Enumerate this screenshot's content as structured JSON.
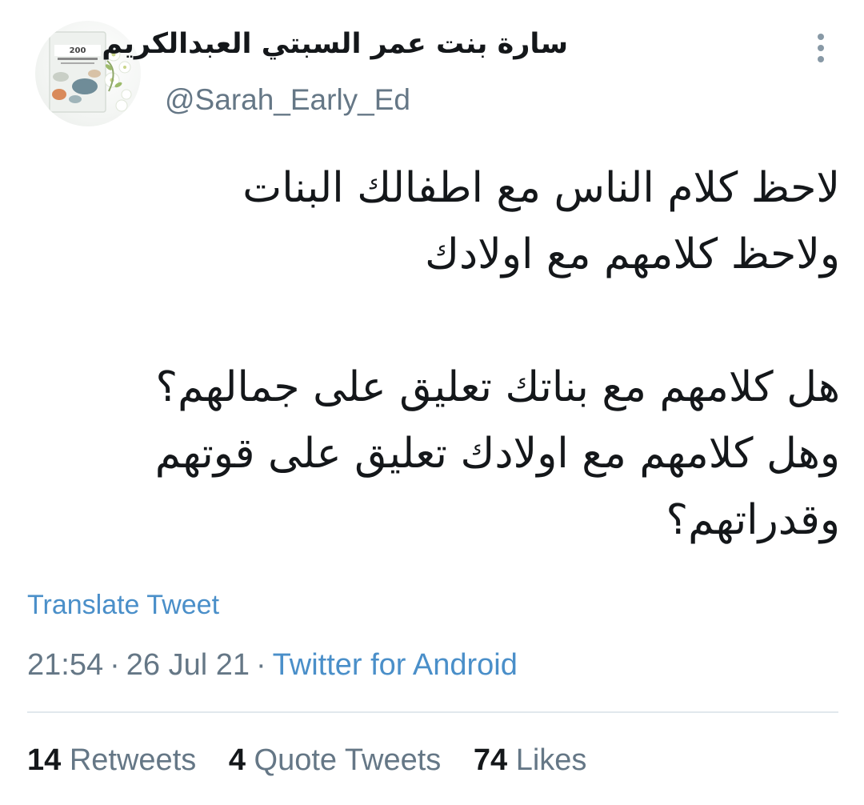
{
  "tweet": {
    "display_name": "سارة بنت عمر السبتي العبدالكريم",
    "handle": "@Sarah_Early_Ed",
    "avatar": {
      "book_number": "200",
      "icon": "book-cover-avatar"
    },
    "text_lines": [
      "لاحظ كلام الناس مع اطفالك البنات",
      "ولاحظ كلامهم مع اولادك",
      "",
      "هل كلامهم مع بناتك تعليق على جمالهم؟",
      "وهل كلامهم مع اولادك تعليق على قوتهم",
      "وقدراتهم؟"
    ],
    "translate_label": "Translate Tweet",
    "time": "21:54",
    "date": "26 Jul 21",
    "separator": "·",
    "source": "Twitter for Android",
    "stats": {
      "retweets_count": "14",
      "retweets_label": "Retweets",
      "quotes_count": "4",
      "quotes_label": "Quote Tweets",
      "likes_count": "74",
      "likes_label": "Likes"
    }
  },
  "colors": {
    "text": "#14171a",
    "secondary": "#657786",
    "link": "#4a8fc9",
    "divider": "#e1e8ed"
  }
}
